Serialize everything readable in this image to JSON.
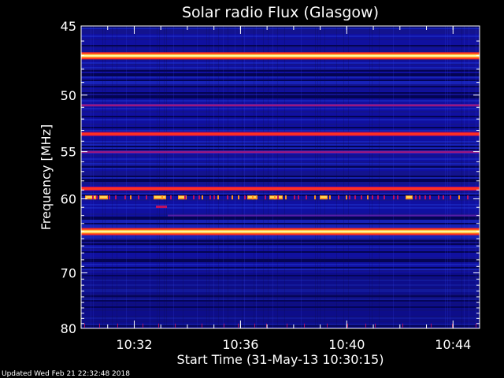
{
  "chart_data": {
    "type": "heatmap",
    "title": "Solar radio Flux (Glasgow)",
    "xlabel": "Start Time (31-May-13 10:30:15)",
    "ylabel": "Frequency [MHz]",
    "footer": "Updated Wed Feb 21 22:32:48 2018",
    "x_ticks": [
      "10:32",
      "10:36",
      "10:40",
      "10:44"
    ],
    "y_ticks": [
      45,
      50,
      55,
      60,
      70,
      80
    ],
    "x_range_minutes": [
      10.5,
      10.75
    ],
    "y_range_mhz": [
      45,
      80
    ],
    "y_scale": "reciprocal",
    "colormap": [
      "#00003a",
      "#1010a0",
      "#2838e0",
      "#c01060",
      "#ff3020",
      "#ff9020",
      "#ffe860",
      "#ffffd0"
    ],
    "emission_bands": [
      {
        "freq_mhz": 47.0,
        "intensity": "very-high"
      },
      {
        "freq_mhz": 50.8,
        "intensity": "medium"
      },
      {
        "freq_mhz": 53.3,
        "intensity": "high"
      },
      {
        "freq_mhz": 55.0,
        "intensity": "medium"
      },
      {
        "freq_mhz": 58.8,
        "intensity": "high"
      },
      {
        "freq_mhz": 64.0,
        "intensity": "very-high"
      }
    ]
  }
}
